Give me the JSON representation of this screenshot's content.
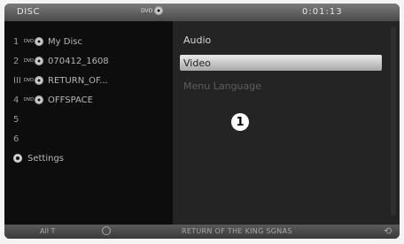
{
  "topbar": {
    "source_label": "DISC",
    "disc_badge": "DVD",
    "time": "0:01:13"
  },
  "left_menu": {
    "items": [
      {
        "num": "1",
        "badge": "DVD",
        "label": "My Disc"
      },
      {
        "num": "2",
        "badge": "DVD",
        "label": "070412_1608"
      },
      {
        "num": "III",
        "badge": "DVD",
        "label": "RETURN_OF..."
      },
      {
        "num": "4",
        "badge": "DVD",
        "label": "OFFSPACE"
      },
      {
        "num": "5",
        "badge": "",
        "label": ""
      },
      {
        "num": "6",
        "badge": "",
        "label": ""
      }
    ],
    "settings_label": "Settings",
    "settings_icon": "gear-icon"
  },
  "right_menu": {
    "items": [
      {
        "label": "Audio",
        "state": "normal"
      },
      {
        "label": "Video",
        "state": "selected"
      },
      {
        "label": "Menu Language",
        "state": "disabled"
      }
    ]
  },
  "callout": "1",
  "bottombar": {
    "left_text": "All T",
    "title": "RETURN OF THE KING SGNAS"
  }
}
